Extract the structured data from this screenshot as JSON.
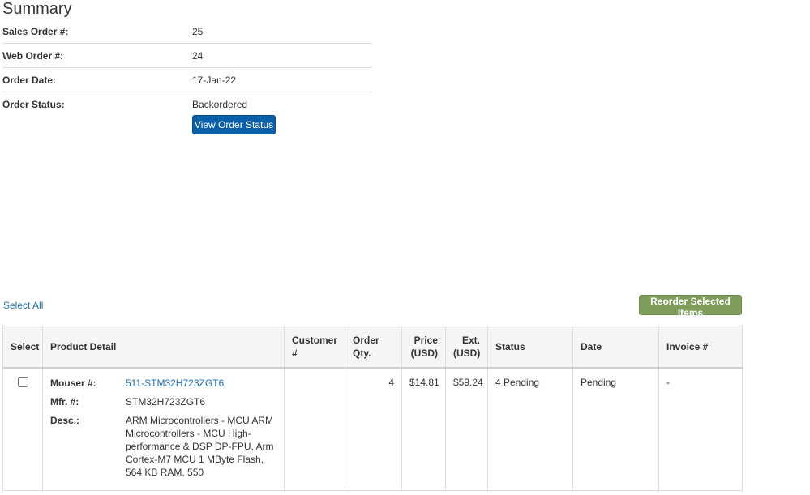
{
  "page": {
    "title": "Summary"
  },
  "summary": {
    "rows": [
      {
        "label": "Sales Order #:",
        "value": "25"
      },
      {
        "label": "Web Order #:",
        "value": "24"
      },
      {
        "label": "Order Date:",
        "value": "17-Jan-22"
      },
      {
        "label": "Order Status:",
        "value": "Backordered"
      }
    ],
    "view_status_label": "View Order Status"
  },
  "actions": {
    "select_all": "Select All",
    "reorder_label": "Reorder Selected Items"
  },
  "table": {
    "headers": {
      "select": "Select",
      "product_detail": "Product Detail",
      "customer": "Customer #",
      "order_qty": "Order Qty.",
      "price_line1": "Price",
      "price_line2": "(USD)",
      "ext_line1": "Ext.",
      "ext_line2": "(USD)",
      "status": "Status",
      "date": "Date",
      "invoice": "Invoice #"
    },
    "rows": [
      {
        "selected": false,
        "mouser_label": "Mouser #:",
        "mouser_no": "511-STM32H723ZGT6",
        "mfr_label": "Mfr. #:",
        "mfr_no": "STM32H723ZGT6",
        "desc_label": "Desc.:",
        "desc": "ARM Microcontrollers - MCU ARM Microcontrollers - MCU High-performance & DSP DP-FPU, Arm Cortex-M7 MCU 1 MByte Flash, 564 KB RAM, 550",
        "customer_no": "",
        "order_qty": "4",
        "price": "$14.81",
        "ext": "$59.24",
        "status": "4 Pending",
        "date": "Pending",
        "invoice": "-"
      }
    ]
  },
  "colors": {
    "primary_button": "#0b5ea8",
    "reorder_button": "#7f9e5c",
    "link": "#1f6fb5"
  }
}
